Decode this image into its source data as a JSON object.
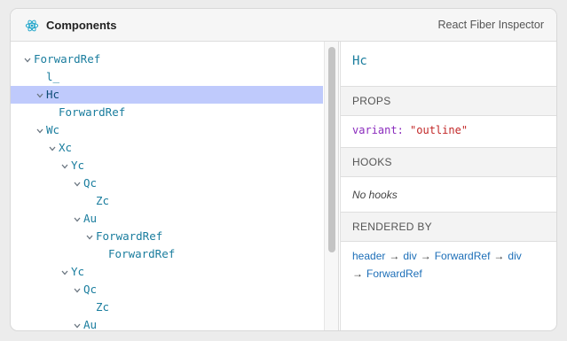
{
  "header": {
    "title": "Components",
    "subtitle": "React Fiber Inspector",
    "logo_icon": "react-atom-icon"
  },
  "tree": {
    "rows": [
      {
        "label": "ForwardRef",
        "depth": 0,
        "expanded": true,
        "selected": false
      },
      {
        "label": "l_",
        "depth": 1,
        "expanded": null,
        "selected": false
      },
      {
        "label": "Hc",
        "depth": 1,
        "expanded": true,
        "selected": true
      },
      {
        "label": "ForwardRef",
        "depth": 2,
        "expanded": null,
        "selected": false
      },
      {
        "label": "Wc",
        "depth": 1,
        "expanded": true,
        "selected": false
      },
      {
        "label": "Xc",
        "depth": 2,
        "expanded": true,
        "selected": false
      },
      {
        "label": "Yc",
        "depth": 3,
        "expanded": true,
        "selected": false
      },
      {
        "label": "Qc",
        "depth": 4,
        "expanded": true,
        "selected": false
      },
      {
        "label": "Zc",
        "depth": 5,
        "expanded": null,
        "selected": false
      },
      {
        "label": "Au",
        "depth": 4,
        "expanded": true,
        "selected": false
      },
      {
        "label": "ForwardRef",
        "depth": 5,
        "expanded": true,
        "selected": false
      },
      {
        "label": "ForwardRef",
        "depth": 6,
        "expanded": null,
        "selected": false
      },
      {
        "label": "Yc",
        "depth": 3,
        "expanded": true,
        "selected": false
      },
      {
        "label": "Qc",
        "depth": 4,
        "expanded": true,
        "selected": false
      },
      {
        "label": "Zc",
        "depth": 5,
        "expanded": null,
        "selected": false
      },
      {
        "label": "Au",
        "depth": 4,
        "expanded": true,
        "selected": false
      }
    ]
  },
  "details": {
    "selected_name": "Hc",
    "props_heading": "PROPS",
    "props": [
      {
        "key": "variant:",
        "value": "\"outline\""
      }
    ],
    "hooks_heading": "HOOKS",
    "hooks_empty": "No hooks",
    "rendered_by_heading": "RENDERED BY",
    "rendered_by_line1": [
      "header",
      "div",
      "ForwardRef",
      "div"
    ],
    "rendered_by_line2": [
      "ForwardRef"
    ],
    "arrow": "→"
  },
  "colors": {
    "selection": "#bfcafc",
    "component_name": "#1a7d9e",
    "prop_key": "#8a2bbd",
    "prop_value": "#c22727",
    "link": "#1d6fb8"
  }
}
